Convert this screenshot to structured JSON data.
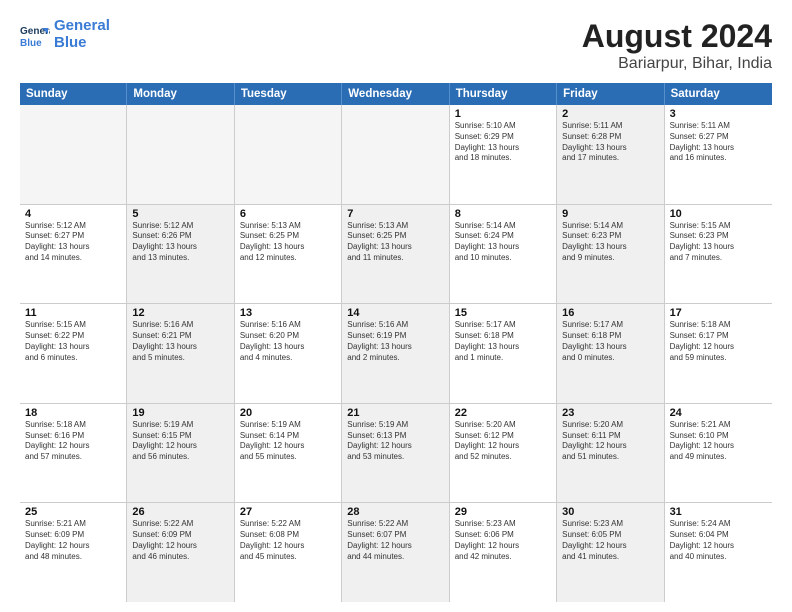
{
  "logo": {
    "line1": "General",
    "line2": "Blue"
  },
  "title": "August 2024",
  "subtitle": "Bariarpur, Bihar, India",
  "days": [
    "Sunday",
    "Monday",
    "Tuesday",
    "Wednesday",
    "Thursday",
    "Friday",
    "Saturday"
  ],
  "rows": [
    [
      {
        "day": "",
        "text": "",
        "empty": true
      },
      {
        "day": "",
        "text": "",
        "empty": true
      },
      {
        "day": "",
        "text": "",
        "empty": true
      },
      {
        "day": "",
        "text": "",
        "empty": true
      },
      {
        "day": "1",
        "text": "Sunrise: 5:10 AM\nSunset: 6:29 PM\nDaylight: 13 hours\nand 18 minutes."
      },
      {
        "day": "2",
        "text": "Sunrise: 5:11 AM\nSunset: 6:28 PM\nDaylight: 13 hours\nand 17 minutes.",
        "shaded": true
      },
      {
        "day": "3",
        "text": "Sunrise: 5:11 AM\nSunset: 6:27 PM\nDaylight: 13 hours\nand 16 minutes."
      }
    ],
    [
      {
        "day": "4",
        "text": "Sunrise: 5:12 AM\nSunset: 6:27 PM\nDaylight: 13 hours\nand 14 minutes."
      },
      {
        "day": "5",
        "text": "Sunrise: 5:12 AM\nSunset: 6:26 PM\nDaylight: 13 hours\nand 13 minutes.",
        "shaded": true
      },
      {
        "day": "6",
        "text": "Sunrise: 5:13 AM\nSunset: 6:25 PM\nDaylight: 13 hours\nand 12 minutes."
      },
      {
        "day": "7",
        "text": "Sunrise: 5:13 AM\nSunset: 6:25 PM\nDaylight: 13 hours\nand 11 minutes.",
        "shaded": true
      },
      {
        "day": "8",
        "text": "Sunrise: 5:14 AM\nSunset: 6:24 PM\nDaylight: 13 hours\nand 10 minutes."
      },
      {
        "day": "9",
        "text": "Sunrise: 5:14 AM\nSunset: 6:23 PM\nDaylight: 13 hours\nand 9 minutes.",
        "shaded": true
      },
      {
        "day": "10",
        "text": "Sunrise: 5:15 AM\nSunset: 6:23 PM\nDaylight: 13 hours\nand 7 minutes."
      }
    ],
    [
      {
        "day": "11",
        "text": "Sunrise: 5:15 AM\nSunset: 6:22 PM\nDaylight: 13 hours\nand 6 minutes."
      },
      {
        "day": "12",
        "text": "Sunrise: 5:16 AM\nSunset: 6:21 PM\nDaylight: 13 hours\nand 5 minutes.",
        "shaded": true
      },
      {
        "day": "13",
        "text": "Sunrise: 5:16 AM\nSunset: 6:20 PM\nDaylight: 13 hours\nand 4 minutes."
      },
      {
        "day": "14",
        "text": "Sunrise: 5:16 AM\nSunset: 6:19 PM\nDaylight: 13 hours\nand 2 minutes.",
        "shaded": true
      },
      {
        "day": "15",
        "text": "Sunrise: 5:17 AM\nSunset: 6:18 PM\nDaylight: 13 hours\nand 1 minute."
      },
      {
        "day": "16",
        "text": "Sunrise: 5:17 AM\nSunset: 6:18 PM\nDaylight: 13 hours\nand 0 minutes.",
        "shaded": true
      },
      {
        "day": "17",
        "text": "Sunrise: 5:18 AM\nSunset: 6:17 PM\nDaylight: 12 hours\nand 59 minutes."
      }
    ],
    [
      {
        "day": "18",
        "text": "Sunrise: 5:18 AM\nSunset: 6:16 PM\nDaylight: 12 hours\nand 57 minutes."
      },
      {
        "day": "19",
        "text": "Sunrise: 5:19 AM\nSunset: 6:15 PM\nDaylight: 12 hours\nand 56 minutes.",
        "shaded": true
      },
      {
        "day": "20",
        "text": "Sunrise: 5:19 AM\nSunset: 6:14 PM\nDaylight: 12 hours\nand 55 minutes."
      },
      {
        "day": "21",
        "text": "Sunrise: 5:19 AM\nSunset: 6:13 PM\nDaylight: 12 hours\nand 53 minutes.",
        "shaded": true
      },
      {
        "day": "22",
        "text": "Sunrise: 5:20 AM\nSunset: 6:12 PM\nDaylight: 12 hours\nand 52 minutes."
      },
      {
        "day": "23",
        "text": "Sunrise: 5:20 AM\nSunset: 6:11 PM\nDaylight: 12 hours\nand 51 minutes.",
        "shaded": true
      },
      {
        "day": "24",
        "text": "Sunrise: 5:21 AM\nSunset: 6:10 PM\nDaylight: 12 hours\nand 49 minutes."
      }
    ],
    [
      {
        "day": "25",
        "text": "Sunrise: 5:21 AM\nSunset: 6:09 PM\nDaylight: 12 hours\nand 48 minutes."
      },
      {
        "day": "26",
        "text": "Sunrise: 5:22 AM\nSunset: 6:09 PM\nDaylight: 12 hours\nand 46 minutes.",
        "shaded": true
      },
      {
        "day": "27",
        "text": "Sunrise: 5:22 AM\nSunset: 6:08 PM\nDaylight: 12 hours\nand 45 minutes."
      },
      {
        "day": "28",
        "text": "Sunrise: 5:22 AM\nSunset: 6:07 PM\nDaylight: 12 hours\nand 44 minutes.",
        "shaded": true
      },
      {
        "day": "29",
        "text": "Sunrise: 5:23 AM\nSunset: 6:06 PM\nDaylight: 12 hours\nand 42 minutes."
      },
      {
        "day": "30",
        "text": "Sunrise: 5:23 AM\nSunset: 6:05 PM\nDaylight: 12 hours\nand 41 minutes.",
        "shaded": true
      },
      {
        "day": "31",
        "text": "Sunrise: 5:24 AM\nSunset: 6:04 PM\nDaylight: 12 hours\nand 40 minutes."
      }
    ]
  ]
}
